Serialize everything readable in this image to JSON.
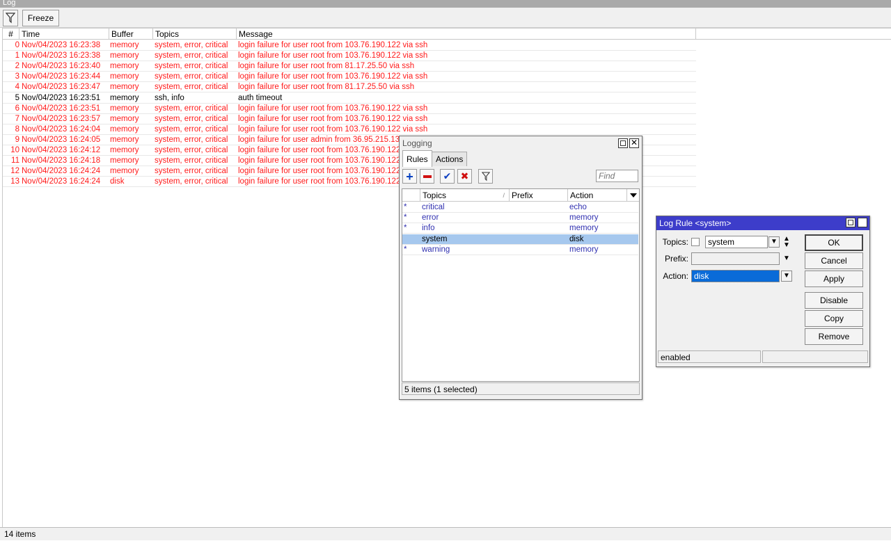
{
  "window": {
    "title": "Log"
  },
  "toolbar": {
    "filter_icon": "filter-icon",
    "freeze_label": "Freeze"
  },
  "log": {
    "columns": [
      "#",
      "Time",
      "Buffer",
      "Topics",
      "Message"
    ],
    "rows": [
      {
        "n": "0",
        "time": "Nov/04/2023 16:23:38",
        "buffer": "memory",
        "topics": "system, error, critical",
        "message": "login failure for user root from 103.76.190.122 via ssh",
        "error": true
      },
      {
        "n": "1",
        "time": "Nov/04/2023 16:23:38",
        "buffer": "memory",
        "topics": "system, error, critical",
        "message": "login failure for user root from 103.76.190.122 via ssh",
        "error": true
      },
      {
        "n": "2",
        "time": "Nov/04/2023 16:23:40",
        "buffer": "memory",
        "topics": "system, error, critical",
        "message": "login failure for user root from 81.17.25.50 via ssh",
        "error": true
      },
      {
        "n": "3",
        "time": "Nov/04/2023 16:23:44",
        "buffer": "memory",
        "topics": "system, error, critical",
        "message": "login failure for user root from 103.76.190.122 via ssh",
        "error": true
      },
      {
        "n": "4",
        "time": "Nov/04/2023 16:23:47",
        "buffer": "memory",
        "topics": "system, error, critical",
        "message": "login failure for user root from 81.17.25.50 via ssh",
        "error": true
      },
      {
        "n": "5",
        "time": "Nov/04/2023 16:23:51",
        "buffer": "memory",
        "topics": "ssh, info",
        "message": "auth timeout",
        "error": false
      },
      {
        "n": "6",
        "time": "Nov/04/2023 16:23:51",
        "buffer": "memory",
        "topics": "system, error, critical",
        "message": "login failure for user root from 103.76.190.122 via ssh",
        "error": true
      },
      {
        "n": "7",
        "time": "Nov/04/2023 16:23:57",
        "buffer": "memory",
        "topics": "system, error, critical",
        "message": "login failure for user root from 103.76.190.122 via ssh",
        "error": true
      },
      {
        "n": "8",
        "time": "Nov/04/2023 16:24:04",
        "buffer": "memory",
        "topics": "system, error, critical",
        "message": "login failure for user root from 103.76.190.122 via ssh",
        "error": true
      },
      {
        "n": "9",
        "time": "Nov/04/2023 16:24:05",
        "buffer": "memory",
        "topics": "system, error, critical",
        "message": "login failure for user admin from 36.95.215.138 via ssh",
        "error": true
      },
      {
        "n": "10",
        "time": "Nov/04/2023 16:24:12",
        "buffer": "memory",
        "topics": "system, error, critical",
        "message": "login failure for user root from 103.76.190.122 via ssh",
        "error": true
      },
      {
        "n": "11",
        "time": "Nov/04/2023 16:24:18",
        "buffer": "memory",
        "topics": "system, error, critical",
        "message": "login failure for user root from 103.76.190.122 via ssh",
        "error": true
      },
      {
        "n": "12",
        "time": "Nov/04/2023 16:24:24",
        "buffer": "memory",
        "topics": "system, error, critical",
        "message": "login failure for user root from 103.76.190.122 via ssh",
        "error": true
      },
      {
        "n": "13",
        "time": "Nov/04/2023 16:24:24",
        "buffer": "disk",
        "topics": "system, error, critical",
        "message": "login failure for user root from 103.76.190.122 via ssh",
        "error": true
      }
    ],
    "status": "14 items"
  },
  "logging": {
    "title": "Logging",
    "tabs": [
      "Rules",
      "Actions"
    ],
    "find_placeholder": "Find",
    "columns": [
      "Topics",
      "Prefix",
      "Action"
    ],
    "rows": [
      {
        "flag": "*",
        "topics": "critical",
        "prefix": "",
        "action": "echo",
        "selected": false
      },
      {
        "flag": "*",
        "topics": "error",
        "prefix": "",
        "action": "memory",
        "selected": false
      },
      {
        "flag": "*",
        "topics": "info",
        "prefix": "",
        "action": "memory",
        "selected": false
      },
      {
        "flag": "",
        "topics": "system",
        "prefix": "",
        "action": "disk",
        "selected": true
      },
      {
        "flag": "*",
        "topics": "warning",
        "prefix": "",
        "action": "memory",
        "selected": false
      }
    ],
    "status": "5 items (1 selected)"
  },
  "log_rule": {
    "title": "Log Rule <system>",
    "topics_label": "Topics:",
    "topics_value": "system",
    "prefix_label": "Prefix:",
    "prefix_value": "",
    "action_label": "Action:",
    "action_value": "disk",
    "buttons": {
      "ok": "OK",
      "cancel": "Cancel",
      "apply": "Apply",
      "disable": "Disable",
      "copy": "Copy",
      "remove": "Remove"
    },
    "status": "enabled"
  },
  "colors": {
    "error_text": "#ff1a1a",
    "selected_row": "#a6c8ee",
    "dialog_title": "#3d3dca",
    "rule_text": "#3030b0"
  }
}
